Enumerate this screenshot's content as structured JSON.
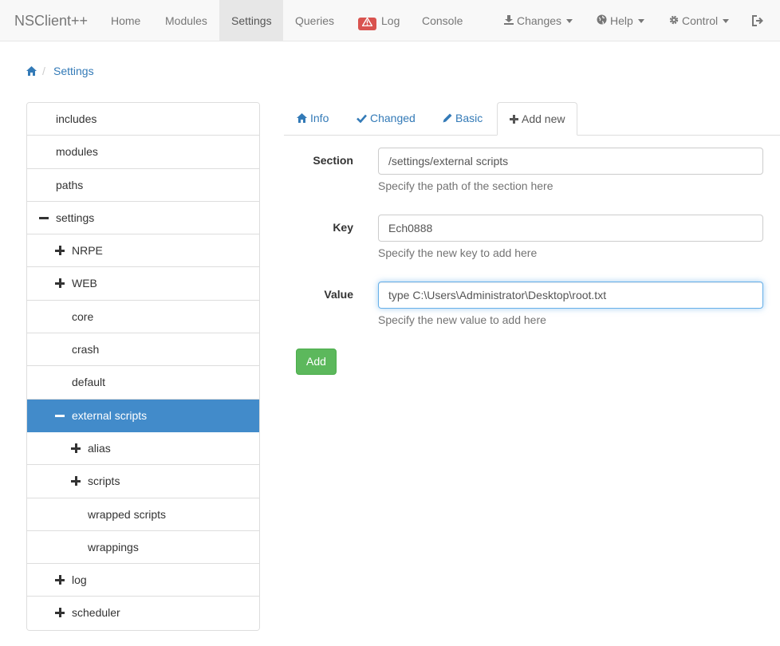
{
  "navbar": {
    "brand": "NSClient++",
    "items": [
      {
        "label": "Home"
      },
      {
        "label": "Modules"
      },
      {
        "label": "Settings",
        "active": true
      },
      {
        "label": "Queries"
      },
      {
        "label": "Log",
        "badge_icon": "warning-icon",
        "badge_color": "#d9534f"
      },
      {
        "label": "Console"
      }
    ],
    "right": [
      {
        "label": "Changes",
        "icon": "download-icon"
      },
      {
        "label": "Help",
        "icon": "globe-icon"
      },
      {
        "label": "Control",
        "icon": "gear-icon"
      }
    ],
    "logout_icon": "logout-icon"
  },
  "breadcrumb": {
    "home_icon": "home-icon",
    "separator": "/",
    "current": "Settings"
  },
  "tree": {
    "selected_color": "#428bca",
    "items": [
      {
        "label": "includes",
        "sign": ""
      },
      {
        "label": "modules",
        "sign": ""
      },
      {
        "label": "paths",
        "sign": ""
      },
      {
        "label": "settings",
        "sign": "minus"
      },
      {
        "label": "NRPE",
        "sign": "plus"
      },
      {
        "label": "WEB",
        "sign": "plus"
      },
      {
        "label": "core",
        "sign": ""
      },
      {
        "label": "crash",
        "sign": ""
      },
      {
        "label": "default",
        "sign": ""
      },
      {
        "label": "external scripts",
        "sign": "minus",
        "selected": true
      },
      {
        "label": "alias",
        "sign": "plus"
      },
      {
        "label": "scripts",
        "sign": "plus"
      },
      {
        "label": "wrapped scripts",
        "sign": ""
      },
      {
        "label": "wrappings",
        "sign": ""
      },
      {
        "label": "log",
        "sign": "plus"
      },
      {
        "label": "scheduler",
        "sign": "plus"
      }
    ]
  },
  "tabs": [
    {
      "label": "Info",
      "icon": "home-icon"
    },
    {
      "label": "Changed",
      "icon": "check-icon"
    },
    {
      "label": "Basic",
      "icon": "pencil-icon"
    },
    {
      "label": "Add new",
      "icon": "plus-icon",
      "active": true
    }
  ],
  "form": {
    "section": {
      "label": "Section",
      "value": "/settings/external scripts",
      "help": "Specify the path of the section here"
    },
    "key": {
      "label": "Key",
      "value": "Ech0888",
      "help": "Specify the new key to add here"
    },
    "value": {
      "label": "Value",
      "value": "type C:\\Users\\Administrator\\Desktop\\root.txt",
      "help": "Specify the new value to add here"
    },
    "add_label": "Add",
    "add_color": "#5cb85c"
  }
}
